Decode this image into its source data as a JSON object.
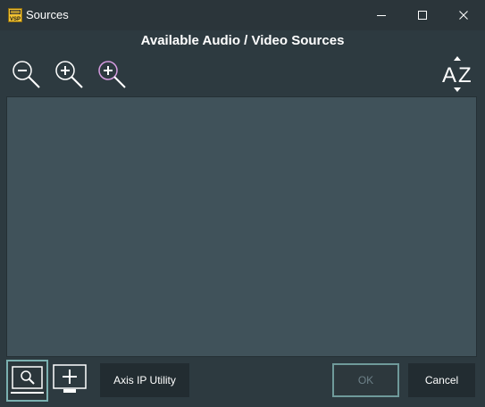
{
  "window": {
    "title": "Sources",
    "app_icon_text": "VSP"
  },
  "heading": "Available Audio / Video Sources",
  "toolbar": {
    "zoom_out": "zoom-out-icon",
    "zoom_in": "zoom-in-icon",
    "zoom_in_alt": "zoom-in-highlighted-icon",
    "sort": "sort-az-icon",
    "sort_letters": [
      "A",
      "Z"
    ]
  },
  "buttons": {
    "axis": "Axis IP Utility",
    "ok": "OK",
    "cancel": "Cancel"
  },
  "colors": {
    "background": "#2d3a40",
    "list_background": "#40525a",
    "accent_border": "#7ab0b0",
    "zoom_highlight": "#d59be0"
  }
}
